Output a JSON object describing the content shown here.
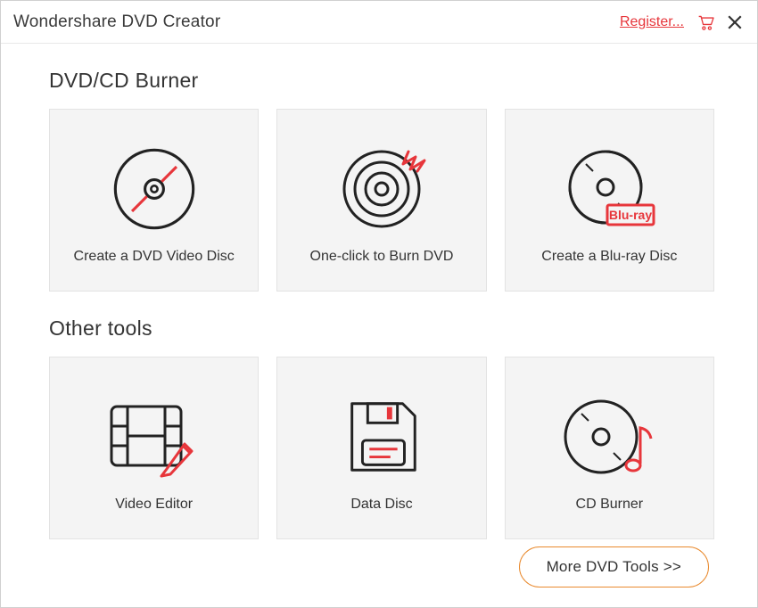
{
  "titlebar": {
    "app_title": "Wondershare DVD Creator",
    "register_label": "Register..."
  },
  "sections": {
    "burner_title": "DVD/CD Burner",
    "other_title": "Other tools"
  },
  "tiles": {
    "dvd_video": "Create a DVD Video Disc",
    "one_click": "One-click to Burn DVD",
    "bluray": "Create a Blu-ray Disc",
    "blu_ray_badge": "Blu-ray",
    "video_editor": "Video Editor",
    "data_disc": "Data Disc",
    "cd_burner": "CD Burner"
  },
  "footer": {
    "more_tools": "More DVD Tools >>"
  }
}
